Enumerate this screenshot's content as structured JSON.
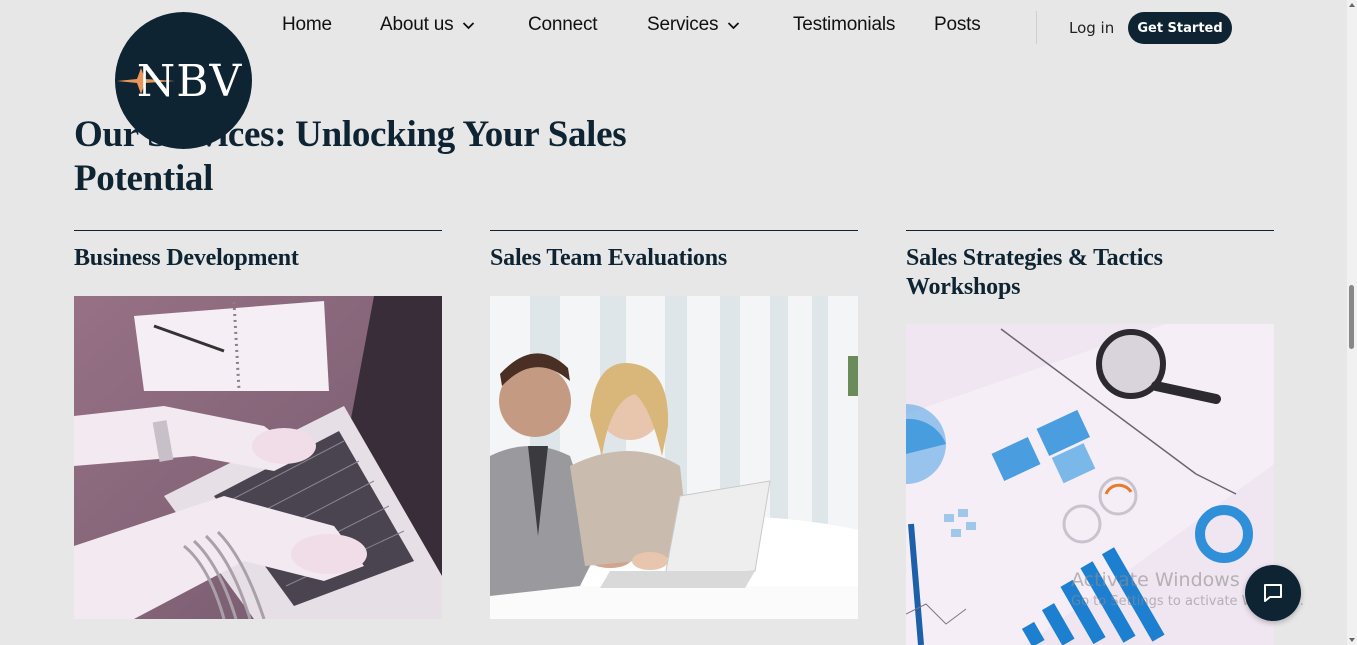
{
  "header": {
    "logo_text": "NBV",
    "nav": [
      {
        "label": "Home"
      },
      {
        "label": "About us",
        "has_dropdown": true
      },
      {
        "label": "Connect"
      },
      {
        "label": "Services",
        "has_dropdown": true
      },
      {
        "label": "Testimonials"
      },
      {
        "label": "Posts"
      }
    ],
    "login_label": "Log in",
    "cta_label": "Get Started"
  },
  "main": {
    "title_line1": "Our Services: Unlocking Your Sales",
    "title_line2": "Potential",
    "cards": [
      {
        "title": "Business Development",
        "image": "woman-typing-on-laptop"
      },
      {
        "title": "Sales Team Evaluations",
        "image": "man-and-woman-at-laptop"
      },
      {
        "title": "Sales Strategies & Tactics Workshops",
        "image": "charts-and-magnifier"
      }
    ]
  },
  "overlay": {
    "watermark_line1": "Activate Windows",
    "watermark_line2": "Go to Settings to activate Windows.",
    "chat_icon": "chat-bubble-icon"
  },
  "colors": {
    "brand_navy": "#0e2433",
    "background": "#e8e7e7",
    "accent_orange": "#e8965a"
  }
}
